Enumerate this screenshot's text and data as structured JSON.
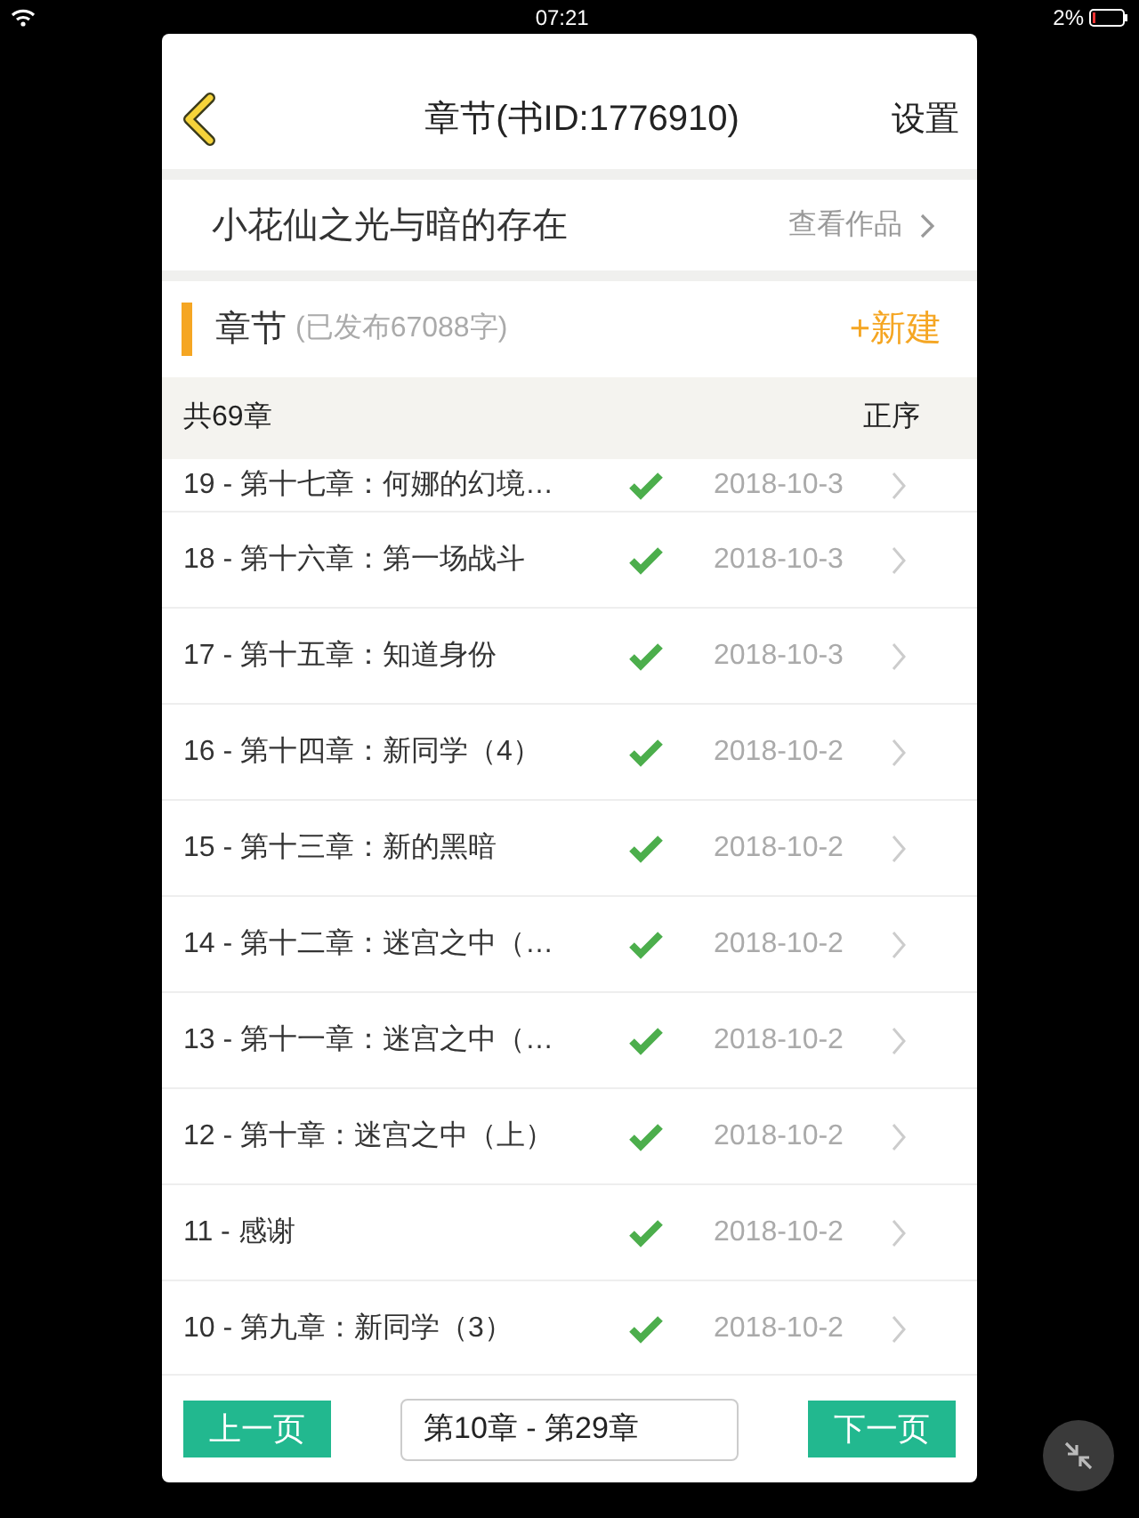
{
  "status_bar": {
    "time": "07:21",
    "battery": "2%"
  },
  "nav": {
    "title": "章节(书ID:1776910)",
    "settings": "设置"
  },
  "book": {
    "title": "小花仙之光与暗的存在",
    "link": "查看作品"
  },
  "section": {
    "title": "章节",
    "subtitle": "(已发布67088字)",
    "new_button": "+新建"
  },
  "list_header": {
    "count": "共69章",
    "sort": "正序"
  },
  "chapters": [
    {
      "title": "19 - 第十七章：何娜的幻境…",
      "published": true,
      "date": "2018-10-3"
    },
    {
      "title": "18 - 第十六章：第一场战斗",
      "published": true,
      "date": "2018-10-3"
    },
    {
      "title": "17 - 第十五章：知道身份",
      "published": true,
      "date": "2018-10-3"
    },
    {
      "title": "16 - 第十四章：新同学（4）",
      "published": true,
      "date": "2018-10-2"
    },
    {
      "title": "15 - 第十三章：新的黑暗",
      "published": true,
      "date": "2018-10-2"
    },
    {
      "title": "14 - 第十二章：迷宫之中（…",
      "published": true,
      "date": "2018-10-2"
    },
    {
      "title": "13 - 第十一章：迷宫之中（…",
      "published": true,
      "date": "2018-10-2"
    },
    {
      "title": "12 - 第十章：迷宫之中（上）",
      "published": true,
      "date": "2018-10-2"
    },
    {
      "title": "11 - 感谢",
      "published": true,
      "date": "2018-10-2"
    },
    {
      "title": "10 - 第九章：新同学（3）",
      "published": true,
      "date": "2018-10-2"
    }
  ],
  "pager": {
    "prev": "上一页",
    "range": "第10章 - 第29章",
    "next": "下一页"
  }
}
